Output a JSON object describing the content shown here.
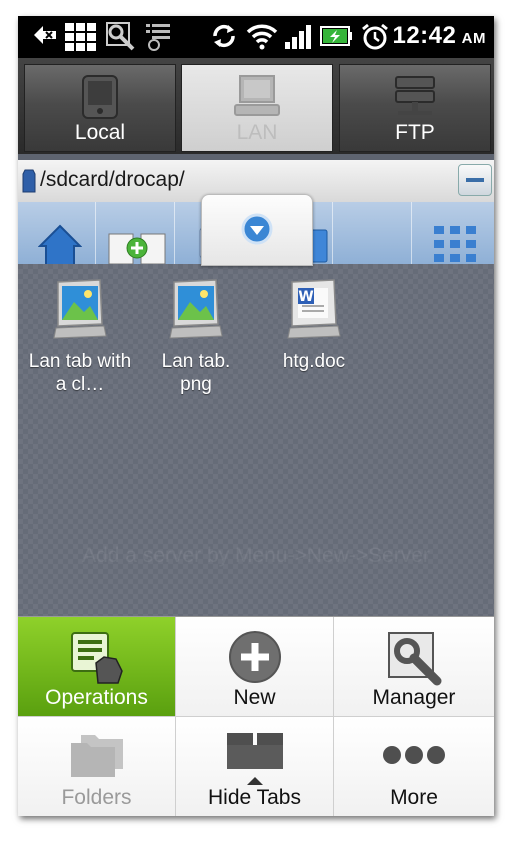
{
  "status_bar": {
    "time": "12:42",
    "ampm": "AM",
    "icons": [
      "back-arrow-icon",
      "grid-icon",
      "wrench-icon",
      "usb-debug-icon",
      "sync-icon",
      "wifi-icon",
      "signal-icon",
      "battery-charging-icon",
      "alarm-icon"
    ]
  },
  "tabs": [
    {
      "label": "Local",
      "icon": "phone-icon",
      "selected": false
    },
    {
      "label": "LAN",
      "icon": "computer-icon",
      "selected": true
    },
    {
      "label": "FTP",
      "icon": "server-icon",
      "selected": false
    }
  ],
  "path": {
    "text": "/sdcard/drocap/"
  },
  "toolbar": {
    "buttons": [
      "home-icon",
      "new-server-icon",
      "list-icon",
      "dropdown-icon",
      "window-icon",
      "thumbnails-icon"
    ]
  },
  "files": [
    {
      "name": "Lan tab with a cl…",
      "type": "image"
    },
    {
      "name": "Lan tab.\npng",
      "type": "image"
    },
    {
      "name": "htg.doc",
      "type": "word"
    }
  ],
  "hint": "Add a server by Menu->New->Server",
  "menu": {
    "items": [
      {
        "label": "Operations",
        "icon": "operations-icon",
        "active": true,
        "disabled": false
      },
      {
        "label": "New",
        "icon": "plus-circle-icon",
        "active": false,
        "disabled": false
      },
      {
        "label": "Manager",
        "icon": "wrench-manager-icon",
        "active": false,
        "disabled": false
      },
      {
        "label": "Folders",
        "icon": "folders-icon",
        "active": false,
        "disabled": true
      },
      {
        "label": "Hide Tabs",
        "icon": "hide-tabs-icon",
        "active": false,
        "disabled": false
      },
      {
        "label": "More",
        "icon": "more-dots-icon",
        "active": false,
        "disabled": false
      }
    ]
  },
  "colors": {
    "active_menu": "#7cc11f",
    "file_area": "#666c78",
    "toolbar": "#9fbbde"
  }
}
